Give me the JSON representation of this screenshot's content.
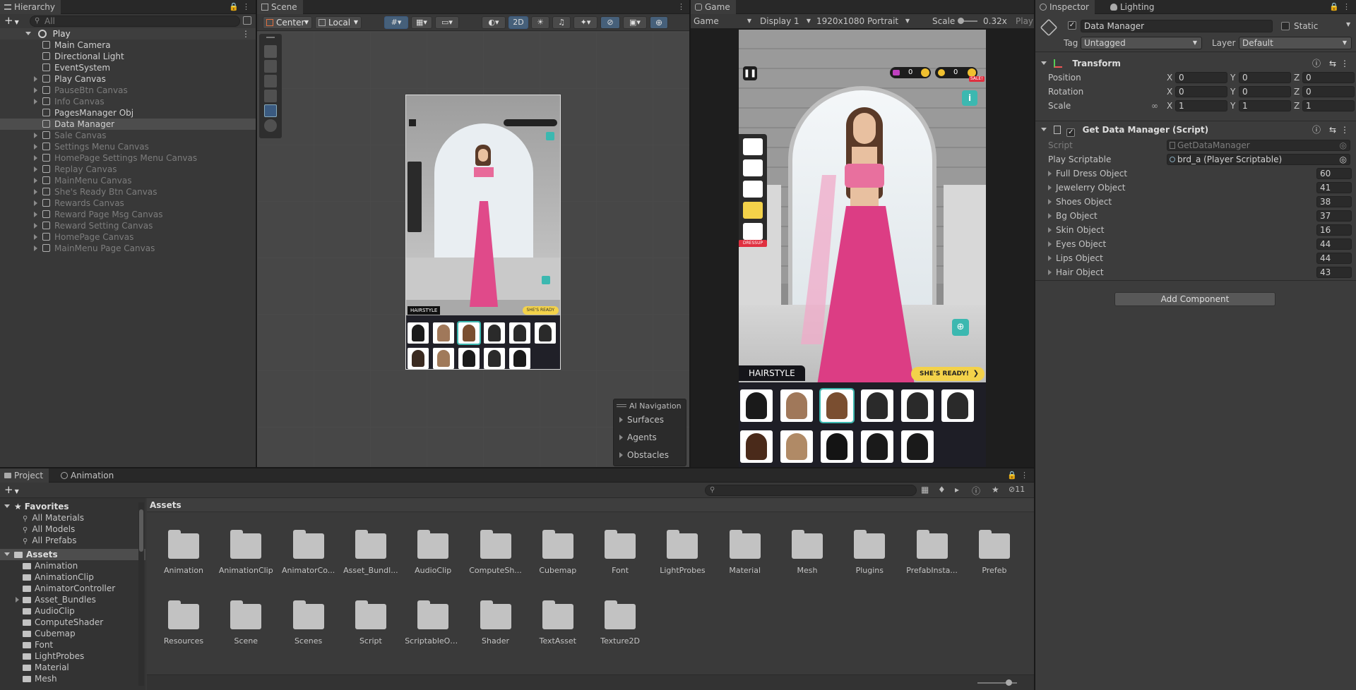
{
  "hierarchy": {
    "tab": "Hierarchy",
    "search_placeholder": "All",
    "scene": "Play",
    "items": [
      {
        "label": "Main Camera",
        "muted": false,
        "expand": false
      },
      {
        "label": "Directional Light",
        "muted": false,
        "expand": false
      },
      {
        "label": "EventSystem",
        "muted": false,
        "expand": false
      },
      {
        "label": "Play Canvas",
        "muted": false,
        "expand": true
      },
      {
        "label": "PauseBtn Canvas",
        "muted": true,
        "expand": true
      },
      {
        "label": "Info Canvas",
        "muted": true,
        "expand": true
      },
      {
        "label": "PagesManager Obj",
        "muted": false,
        "expand": false
      },
      {
        "label": "Data Manager",
        "muted": false,
        "expand": false,
        "selected": true
      },
      {
        "label": "Sale Canvas",
        "muted": true,
        "expand": true
      },
      {
        "label": "Settings Menu Canvas",
        "muted": true,
        "expand": true
      },
      {
        "label": "HomePage Settings Menu Canvas",
        "muted": true,
        "expand": true
      },
      {
        "label": "Replay Canvas",
        "muted": true,
        "expand": true
      },
      {
        "label": "MainMenu Canvas",
        "muted": true,
        "expand": true
      },
      {
        "label": "She's Ready Btn Canvas",
        "muted": true,
        "expand": true
      },
      {
        "label": "Rewards Canvas",
        "muted": true,
        "expand": true
      },
      {
        "label": "Reward Page Msg Canvas",
        "muted": true,
        "expand": true
      },
      {
        "label": "Reward Setting Canvas",
        "muted": true,
        "expand": true
      },
      {
        "label": "HomePage Canvas",
        "muted": true,
        "expand": true
      },
      {
        "label": "MainMenu Page Canvas",
        "muted": true,
        "expand": true
      }
    ]
  },
  "scene": {
    "tab": "Scene",
    "pivot": "Center",
    "space": "Local",
    "mode2d": "2D",
    "ai_nav": {
      "title": "AI Navigation",
      "items": [
        "Surfaces",
        "Agents",
        "Obstacles"
      ]
    },
    "mini_hairstyle": "HAIRSTYLE",
    "mini_ready": "SHE'S READY"
  },
  "game": {
    "tab": "Game",
    "mode": "Game",
    "display": "Display 1",
    "resolution": "1920x1080 Portrait",
    "scale_label": "Scale",
    "scale_value": "0.32x",
    "play_label": "Play",
    "gems": "0",
    "coins": "0",
    "sale": "SALE!",
    "dressup": "DRESSUP",
    "hairstyle": "HAIRSTYLE",
    "ready": "SHE'S READY!"
  },
  "inspector": {
    "tab": "Inspector",
    "tab2": "Lighting",
    "object_name": "Data Manager",
    "static_label": "Static",
    "tag_label": "Tag",
    "tag_value": "Untagged",
    "layer_label": "Layer",
    "layer_value": "Default",
    "transform": {
      "title": "Transform",
      "rows": [
        {
          "label": "Position",
          "x": "0",
          "y": "0",
          "z": "0"
        },
        {
          "label": "Rotation",
          "x": "0",
          "y": "0",
          "z": "0"
        },
        {
          "label": "Scale",
          "x": "1",
          "y": "1",
          "z": "1"
        }
      ]
    },
    "script_component": {
      "title": "Get Data Manager (Script)",
      "script_label": "Script",
      "script_value": "GetDataManager",
      "play_label": "Play Scriptable",
      "play_value": "brd_a (Player Scriptable)",
      "fields": [
        {
          "label": "Full Dress Object",
          "value": "60"
        },
        {
          "label": "Jewelerry Object",
          "value": "41"
        },
        {
          "label": "Shoes Object",
          "value": "38"
        },
        {
          "label": "Bg Object",
          "value": "37"
        },
        {
          "label": "Skin Object",
          "value": "16"
        },
        {
          "label": "Eyes Object",
          "value": "44"
        },
        {
          "label": "Lips Object",
          "value": "44"
        },
        {
          "label": "Hair Object",
          "value": "43"
        }
      ]
    },
    "add_component": "Add Component"
  },
  "project": {
    "tab": "Project",
    "tab2": "Animation",
    "favorites": "Favorites",
    "fav_items": [
      "All Materials",
      "All Models",
      "All Prefabs"
    ],
    "assets": "Assets",
    "tree": [
      "Animation",
      "AnimationClip",
      "AnimatorController",
      "Asset_Bundles",
      "AudioClip",
      "ComputeShader",
      "Cubemap",
      "Font",
      "LightProbes",
      "Material",
      "Mesh"
    ],
    "breadcrumb": "Assets",
    "hidden_count": "11",
    "folders_row1": [
      "Animation",
      "AnimationClip",
      "AnimatorCo...",
      "Asset_Bundl...",
      "AudioClip",
      "ComputeSh...",
      "Cubemap",
      "Font",
      "LightProbes",
      "Material",
      "Mesh",
      "Plugins",
      "PrefabInsta...",
      "Prefeb"
    ],
    "folders_row2": [
      "Resources",
      "Scene",
      "Scenes",
      "Script",
      "ScriptableOb...",
      "Shader",
      "TextAsset",
      "Texture2D"
    ]
  }
}
